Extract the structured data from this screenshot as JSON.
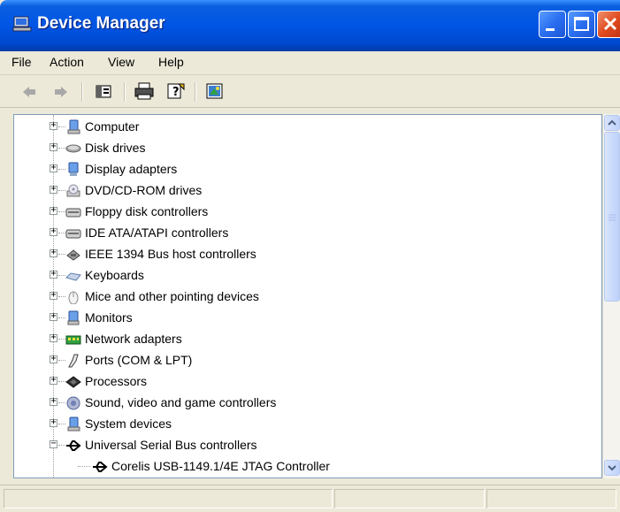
{
  "window": {
    "title": "Device Manager",
    "buttons": {
      "minimize": "minimize",
      "maximize": "maximize",
      "close": "close"
    }
  },
  "menu": {
    "items": [
      {
        "label": "File"
      },
      {
        "label": "Action"
      },
      {
        "label": "View"
      },
      {
        "label": "Help"
      }
    ]
  },
  "toolbar": {
    "buttons": [
      "back-icon",
      "forward-icon",
      "properties-icon",
      "print-icon",
      "help-icon",
      "scan-hardware-icon"
    ]
  },
  "tree": {
    "nodes": [
      {
        "label": "Computer",
        "icon": "computer-icon",
        "expanded": false
      },
      {
        "label": "Disk drives",
        "icon": "disk-drive-icon",
        "expanded": false
      },
      {
        "label": "Display adapters",
        "icon": "display-adapter-icon",
        "expanded": false
      },
      {
        "label": "DVD/CD-ROM drives",
        "icon": "cdrom-icon",
        "expanded": false
      },
      {
        "label": "Floppy disk controllers",
        "icon": "controller-icon",
        "expanded": false
      },
      {
        "label": "IDE ATA/ATAPI controllers",
        "icon": "controller-icon",
        "expanded": false
      },
      {
        "label": "IEEE 1394 Bus host controllers",
        "icon": "firewire-icon",
        "expanded": false
      },
      {
        "label": "Keyboards",
        "icon": "keyboard-icon",
        "expanded": false
      },
      {
        "label": "Mice and other pointing devices",
        "icon": "mouse-icon",
        "expanded": false
      },
      {
        "label": "Monitors",
        "icon": "monitor-icon",
        "expanded": false
      },
      {
        "label": "Network adapters",
        "icon": "network-adapter-icon",
        "expanded": false
      },
      {
        "label": "Ports (COM & LPT)",
        "icon": "port-icon",
        "expanded": false
      },
      {
        "label": "Processors",
        "icon": "processor-icon",
        "expanded": false
      },
      {
        "label": "Sound, video and game controllers",
        "icon": "sound-icon",
        "expanded": false
      },
      {
        "label": "System devices",
        "icon": "system-devices-icon",
        "expanded": false
      },
      {
        "label": "Universal Serial Bus controllers",
        "icon": "usb-icon",
        "expanded": true,
        "children": [
          {
            "label": "Corelis USB-1149.1/4E JTAG Controller",
            "icon": "usb-icon"
          }
        ]
      }
    ]
  },
  "colors": {
    "titlebar": "#0055e5",
    "window_bg": "#ece9d8",
    "tree_bg": "#ffffff",
    "close_button": "#e04b1f"
  }
}
